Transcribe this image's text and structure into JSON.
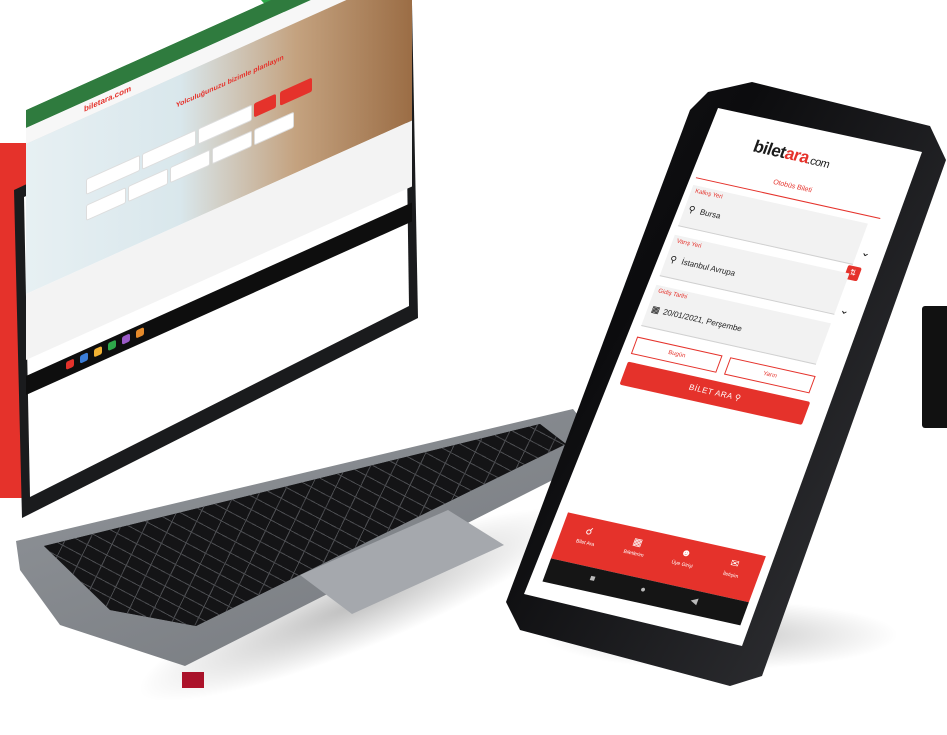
{
  "brand": {
    "name_part1": "bilet",
    "name_part2": "ara",
    "name_suffix": ".com",
    "accent_color": "#e5322b",
    "secondary_color": "#2ea84a"
  },
  "laptop": {
    "logo_text": "biletara.com",
    "hero_title": "Yolculuğunuzu bizimle planlayın"
  },
  "phone": {
    "tab_label": "Otobüs Bileti",
    "fields": [
      {
        "label": "Kalkış Yeri",
        "value": "Bursa",
        "icon": "location-pin-icon"
      },
      {
        "label": "Varış Yeri",
        "value": "İstanbul Avrupa",
        "icon": "location-pin-icon"
      },
      {
        "label": "Gidiş Tarihi",
        "value": "20/01/2021, Perşembe",
        "icon": "calendar-icon"
      }
    ],
    "toggle_one_way": "Bugün",
    "toggle_round": "Yarın",
    "search_button": "BİLET ARA",
    "bottom_nav": [
      {
        "label": "Bilet Ara",
        "icon": "search-icon"
      },
      {
        "label": "Biletlerim",
        "icon": "ticket-icon"
      },
      {
        "label": "Üye Girişi",
        "icon": "user-icon"
      },
      {
        "label": "İletişim",
        "icon": "mail-icon"
      }
    ],
    "system_nav": [
      "■",
      "●",
      "◀"
    ]
  }
}
